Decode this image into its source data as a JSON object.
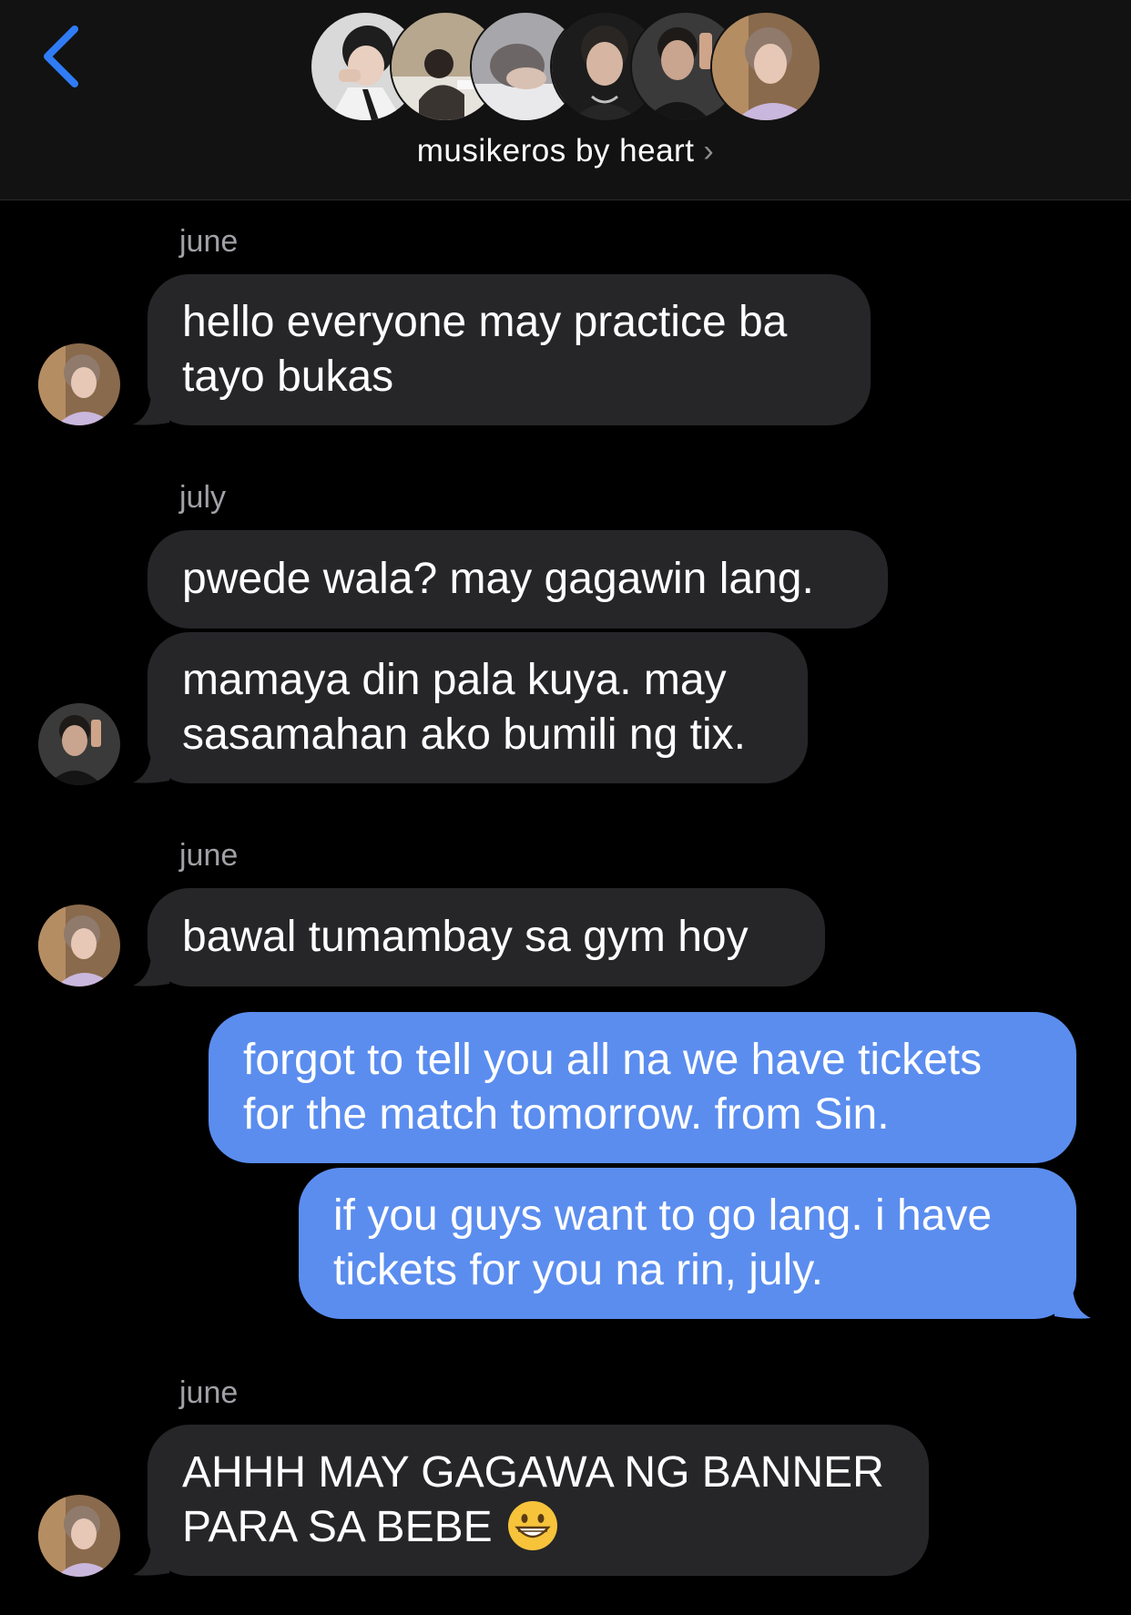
{
  "header": {
    "group_name": "musikeros by heart",
    "chevron": "›",
    "back_icon": "chevron-left-icon",
    "accent": "#2f7cf6"
  },
  "colors": {
    "incoming_bubble": "#262629",
    "outgoing_bubble": "#5b8def",
    "sender_label": "#a0a0a6"
  },
  "messages": [
    {
      "sender": "june",
      "text": "hello everyone may practice ba\ntayo bukas"
    },
    {
      "sender": "july",
      "text": "pwede wala? may gagawin lang."
    },
    {
      "text": "mamaya din pala kuya. may\nsasamahan ako bumili ng tix."
    },
    {
      "sender": "june",
      "text": "bawal tumambay sa gym hoy"
    },
    {
      "text": "forgot to tell you all na we have tickets\nfor the match tomorrow. from Sin."
    },
    {
      "text": "if you guys want to go lang. i have\ntickets for you na rin, july."
    },
    {
      "sender": "june",
      "text": "AHHH MAY GAGAWA NG BANNER\nPARA SA BEBE",
      "emoji": "grinning-face-icon"
    }
  ]
}
